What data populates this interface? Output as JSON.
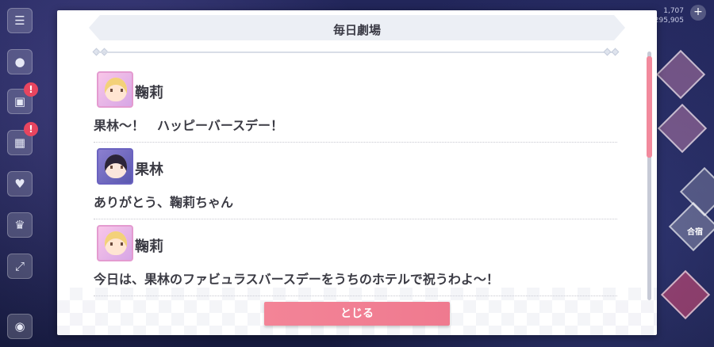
{
  "modal": {
    "title": "毎日劇場",
    "close_label": "とじる"
  },
  "dialogue": [
    {
      "speaker": "鞠莉",
      "text": "果林～！　ハッピーバースデー！"
    },
    {
      "speaker": "果林",
      "text": "ありがとう、鞠莉ちゃん"
    },
    {
      "speaker": "鞠莉",
      "text": "今日は、果林のファビュラスバースデーをうちのホテルで祝うわよ～！"
    }
  ],
  "background": {
    "badge_text": "!",
    "top_stats": [
      "1,707",
      "295,905"
    ],
    "right_label": "合宿"
  },
  "colors": {
    "accent": "#f28a9d",
    "title_bar": "#eceff5",
    "text": "#3b3b44"
  }
}
